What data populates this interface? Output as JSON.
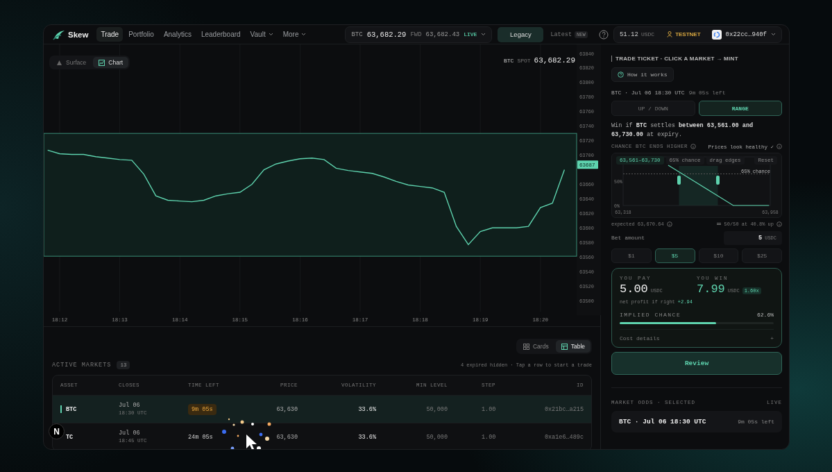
{
  "nav": {
    "brand": "Skew",
    "links": [
      {
        "label": "Trade",
        "selected": true,
        "dropdown": false
      },
      {
        "label": "Portfolio",
        "selected": false,
        "dropdown": false
      },
      {
        "label": "Analytics",
        "selected": false,
        "dropdown": false
      },
      {
        "label": "Leaderboard",
        "selected": false,
        "dropdown": false
      },
      {
        "label": "Vault",
        "selected": false,
        "dropdown": true
      },
      {
        "label": "More",
        "selected": false,
        "dropdown": true
      }
    ]
  },
  "ticker": {
    "asset": "BTC",
    "price": "63,682.29",
    "fwd_label": "FWD",
    "fwd_price": "63,682.43",
    "status": "LIVE"
  },
  "mode_toggle": [
    {
      "label": "Legacy",
      "selected": true
    },
    {
      "label": "Latest",
      "selected": false,
      "badge": "NEW"
    }
  ],
  "account": {
    "balance": "51.12",
    "unit": "USDC",
    "network": "TESTNET",
    "address": "0x22cc…940f"
  },
  "chart": {
    "view_toggle": [
      {
        "label": "Surface",
        "selected": false
      },
      {
        "label": "Chart",
        "selected": true
      }
    ],
    "spot": {
      "asset": "BTC",
      "label": "SPOT",
      "price": "63,682.29"
    },
    "price_tag": "63687",
    "chart_data": {
      "type": "line",
      "categories": [
        null,
        "18:12",
        null,
        null,
        null,
        null,
        "18:13",
        null,
        null,
        null,
        null,
        "18:14",
        null,
        null,
        null,
        null,
        "18:15",
        null,
        null,
        null,
        null,
        "18:16",
        null,
        null,
        null,
        null,
        "18:17",
        null,
        null,
        null,
        null,
        "18:18",
        null,
        null,
        null,
        null,
        "18:19",
        null,
        null,
        null,
        null,
        "18:20",
        null,
        null
      ],
      "series": [
        {
          "color": "#5ed3ae",
          "values": [
            63707,
            63702,
            63701,
            63701,
            63698,
            63696,
            63694,
            63693,
            63674,
            63644,
            63638,
            63637,
            63636,
            63638,
            63644,
            63647,
            63649,
            63660,
            63680,
            63688,
            63692,
            63695,
            63696,
            63694,
            63682,
            63679,
            63677,
            63675,
            63670,
            63664,
            63659,
            63657,
            63655,
            63649,
            63602,
            63577,
            63595,
            63600,
            63600,
            63600,
            63602,
            63628,
            63634,
            63680
          ]
        }
      ],
      "ylim": [
        63500,
        63840
      ],
      "grid": true,
      "yticks": [
        63500,
        63520,
        63540,
        63560,
        63580,
        63600,
        63620,
        63640,
        63660,
        63700,
        63720,
        63740,
        63760,
        63780,
        63800,
        63820,
        63840
      ],
      "bands": [
        {
          "axis": "y",
          "from": 63561,
          "to": 63730
        }
      ]
    }
  },
  "markets": {
    "layout_toggle": [
      {
        "label": "Cards",
        "selected": false
      },
      {
        "label": "Table",
        "selected": true
      }
    ],
    "title": "ACTIVE MARKETS",
    "count": "13",
    "note": "4 expired hidden · Tap a row to start a trade",
    "columns": [
      "ASSET",
      "CLOSES",
      "TIME LEFT",
      "PRICE",
      "VOLATILITY",
      "MIN LEVEL",
      "STEP",
      "ID"
    ],
    "rows": [
      {
        "asset": "BTC",
        "close_date": "Jul 06",
        "close_time": "18:30 UTC",
        "time_left": "9m 05s",
        "urgent": true,
        "price": "63,630",
        "volatility": "33.6%",
        "min_level": "50,000",
        "step": "1.00",
        "id": "0x21bc…a215",
        "selected": true
      },
      {
        "asset": "TC",
        "close_date": "Jul 06",
        "close_time": "18:45 UTC",
        "time_left": "24m 05s",
        "urgent": false,
        "price": "63,630",
        "volatility": "33.6%",
        "min_level": "50,000",
        "step": "1.00",
        "id": "0xa1e6…489c",
        "selected": false
      }
    ]
  },
  "ticket": {
    "title": "TRADE TICKET · CLICK A MARKET → MINT",
    "help": "How it works",
    "market": "BTC · Jul 06 18:30 UTC",
    "time_left": "9m 05s left",
    "modes": [
      {
        "label": "UP / DOWN",
        "selected": false
      },
      {
        "label": "RANGE",
        "selected": true
      }
    ],
    "summary": "Win if **BTC** settles **between** **63,561.00** **and** **63,730.00** at expiry.",
    "chance_label": "CHANCE BTC ENDS HIGHER",
    "health": "Prices look healthy ✓",
    "chips": [
      {
        "label": "63,561–63,730",
        "selected": true
      },
      {
        "label": "65% chance",
        "selected": false
      },
      {
        "label": "drag edges",
        "selected": false
      }
    ],
    "reset": "Reset",
    "chart_data": {
      "type": "line",
      "x": [
        63514,
        63797,
        63953
      ],
      "series": [
        {
          "color": "#5ed3ae",
          "values": [
            83,
            0,
            0
          ]
        }
      ],
      "xlim": [
        63318,
        63958
      ],
      "ylim": [
        0,
        100
      ],
      "xticks": [
        {
          "value": 63318,
          "label": "63,318"
        },
        {
          "value": 63958,
          "label": "63,958"
        }
      ],
      "yticks": [
        {
          "value": 0,
          "label": "0%"
        },
        {
          "value": 50,
          "label": "50%"
        }
      ],
      "ref_lines": [
        {
          "axis": "y",
          "value": 65,
          "label": "65% chance"
        }
      ],
      "bands": [
        {
          "axis": "x",
          "from": 63561,
          "to": 63730
        }
      ]
    },
    "expected": "expected 63,670.64",
    "odds_note": "50/50 at 40.8% up",
    "bet": {
      "label": "Bet amount",
      "value": "5",
      "unit": "USDC"
    },
    "presets": [
      {
        "label": "$1",
        "selected": false
      },
      {
        "label": "$5",
        "selected": true
      },
      {
        "label": "$10",
        "selected": false
      },
      {
        "label": "$25",
        "selected": false
      }
    ],
    "pay": {
      "label": "YOU PAY",
      "amount": "5.00",
      "unit": "USDC"
    },
    "win": {
      "label": "YOU WIN",
      "amount": "7.99",
      "unit": "USDC",
      "multiplier": "1.60x"
    },
    "profit_label": "net profit if right",
    "profit": "+2.94",
    "implied": {
      "label": "IMPLIED CHANCE",
      "value": "62.6%",
      "level": 0.626
    },
    "cost_details": {
      "label": "Cost details",
      "toggle": "+",
      "expanded": false
    },
    "review": "Review",
    "odds": {
      "title": "MARKET ODDS · SELECTED",
      "status": "LIVE",
      "market": "BTC · Jul 06 18:30 UTC",
      "time_left": "9m 05s left"
    }
  },
  "dev_badge": "N"
}
